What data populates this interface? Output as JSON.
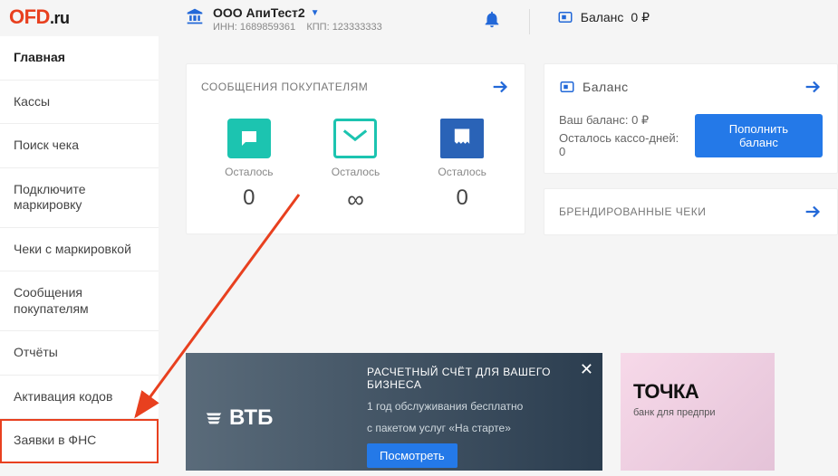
{
  "logo": {
    "brand": "OFD",
    "suffix": ".ru"
  },
  "sidebar": {
    "items": [
      {
        "label": "Главная",
        "active": true
      },
      {
        "label": "Кассы"
      },
      {
        "label": "Поиск чека"
      },
      {
        "label": "Подключите маркировку"
      },
      {
        "label": "Чеки с маркировкой"
      },
      {
        "label": "Сообщения покупателям"
      },
      {
        "label": "Отчёты"
      },
      {
        "label": "Активация кодов"
      },
      {
        "label": "Заявки в ФНС",
        "highlight": true
      }
    ]
  },
  "topbar": {
    "org_name": "ООО АпиТест2",
    "inn_label": "ИНН:",
    "inn_value": "1689859361",
    "kpp_label": "КПП:",
    "kpp_value": "123333333",
    "balance_label": "Баланс",
    "balance_value": "0 ₽"
  },
  "messages_card": {
    "title": "СООБЩЕНИЯ ПОКУПАТЕЛЯМ",
    "remaining_label": "Осталось",
    "sms_remaining": "0",
    "email_remaining": "∞",
    "receipt_remaining": "0"
  },
  "balance_card": {
    "title": "Баланс",
    "your_balance_label": "Ваш баланс:",
    "your_balance_value": "0 ₽",
    "days_label": "Осталось кассо-дней:",
    "days_value": "0",
    "topup_label": "Пополнить баланс"
  },
  "branded_card": {
    "title": "БРЕНДИРОВАННЫЕ ЧЕКИ"
  },
  "promo_vtb": {
    "brand": "ВТБ",
    "title": "РАСЧЕТНЫЙ СЧЁТ ДЛЯ ВАШЕГО БИЗНЕСА",
    "line1": "1 год обслуживания бесплатно",
    "line2": "с пакетом услуг «На старте»",
    "cta": "Посмотреть"
  },
  "promo_tochka": {
    "brand": "ТОЧКА",
    "sub": "банк для предпри"
  }
}
